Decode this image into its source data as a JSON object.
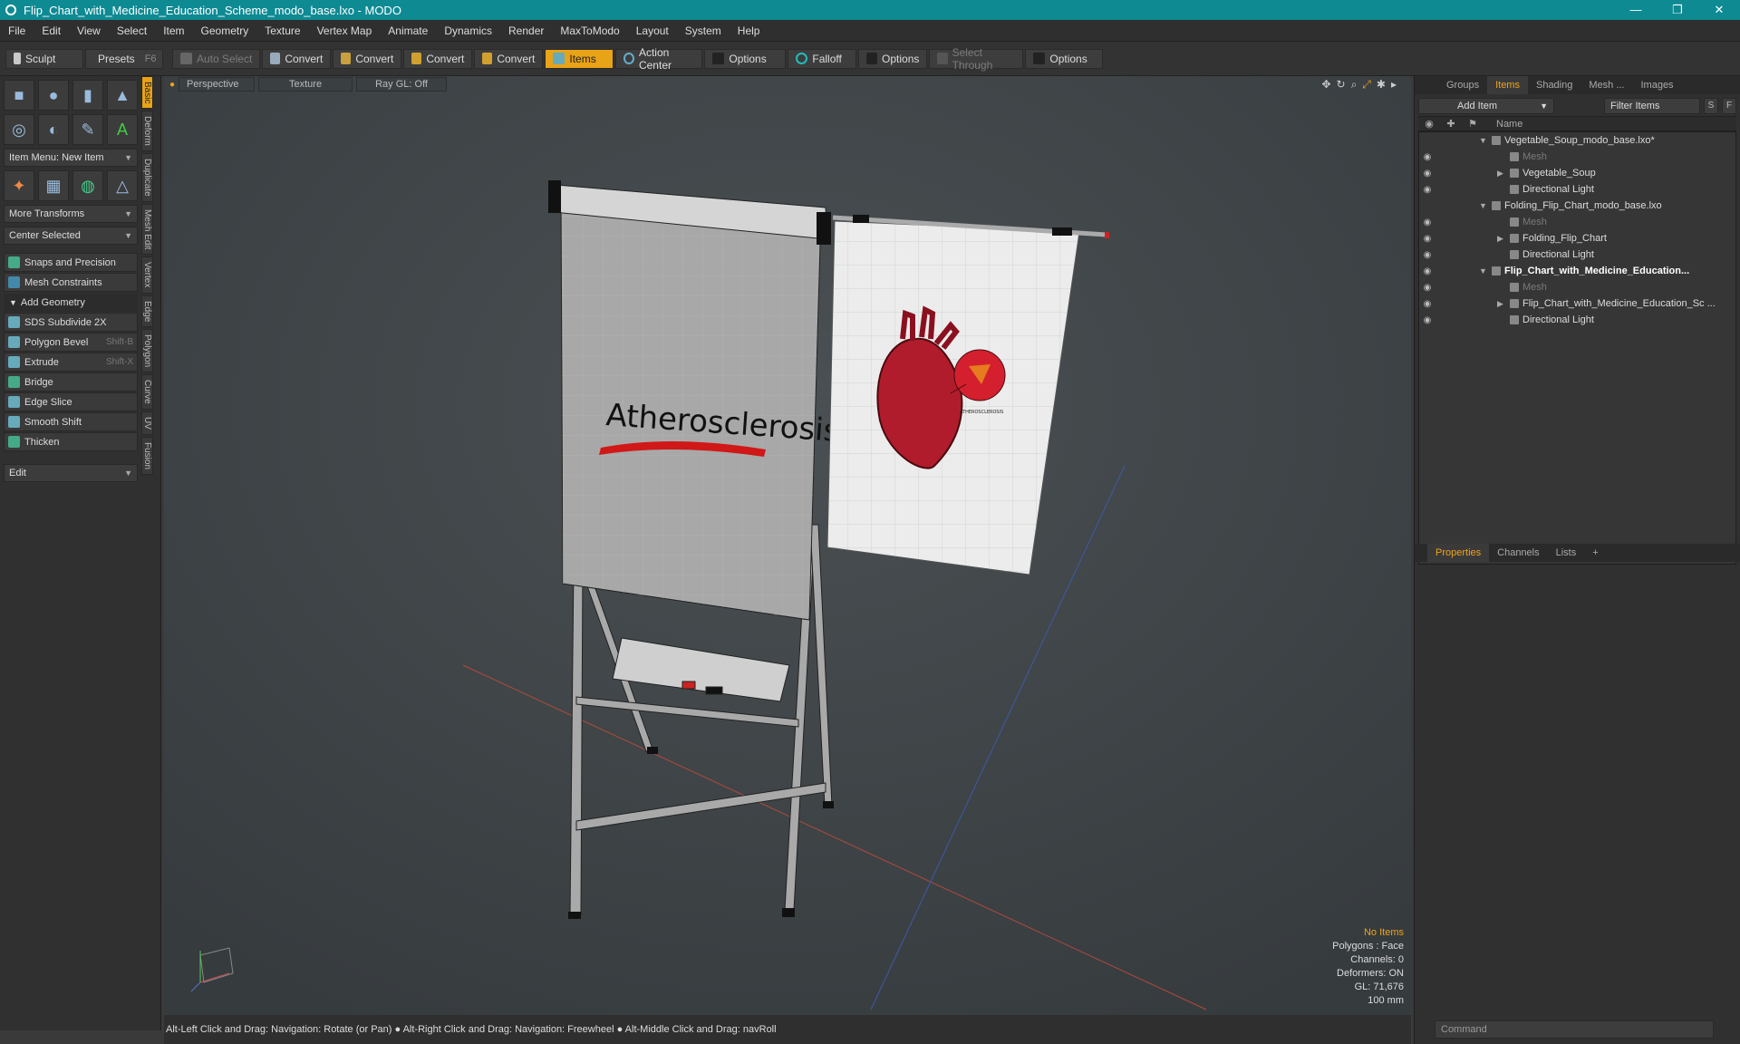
{
  "window": {
    "title": "Flip_Chart_with_Medicine_Education_Scheme_modo_base.lxo - MODO",
    "minimize": "—",
    "maximize": "❐",
    "close": "✕"
  },
  "menu": [
    "File",
    "Edit",
    "View",
    "Select",
    "Item",
    "Geometry",
    "Texture",
    "Vertex Map",
    "Animate",
    "Dynamics",
    "Render",
    "MaxToModo",
    "Layout",
    "System",
    "Help"
  ],
  "toolbar": {
    "sculpt": "Sculpt",
    "presets": "Presets",
    "presets_key": "F6",
    "auto_select": "Auto Select",
    "convert1": "Convert",
    "convert2": "Convert",
    "convert3": "Convert",
    "convert4": "Convert",
    "items": "Items",
    "action_center": "Action Center",
    "options1": "Options",
    "falloff": "Falloff",
    "options2": "Options",
    "select_through": "Select Through",
    "options3": "Options"
  },
  "left": {
    "item_menu": "Item Menu: New Item",
    "more_transforms": "More Transforms",
    "center_selected": "Center Selected",
    "snaps": "Snaps and Precision",
    "mesh_constraints": "Mesh Constraints",
    "add_geometry": "Add Geometry",
    "tools": [
      {
        "label": "SDS Subdivide 2X",
        "key": ""
      },
      {
        "label": "Polygon Bevel",
        "key": "Shift-B"
      },
      {
        "label": "Extrude",
        "key": "Shift-X"
      },
      {
        "label": "Bridge",
        "key": ""
      },
      {
        "label": "Edge Slice",
        "key": ""
      },
      {
        "label": "Smooth Shift",
        "key": ""
      },
      {
        "label": "Thicken",
        "key": ""
      }
    ],
    "edit": "Edit",
    "vtabs": [
      "Basic",
      "Deform",
      "Duplicate",
      "Mesh Edit",
      "Vertex",
      "Edge",
      "Polygon",
      "Curve",
      "UV",
      "Fusion"
    ]
  },
  "viewport": {
    "perspective": "Perspective",
    "texture": "Texture",
    "raygl": "Ray GL: Off",
    "info": {
      "no_items": "No Items",
      "polygons": "Polygons : Face",
      "channels": "Channels: 0",
      "deformers": "Deformers: ON",
      "gl": "GL: 71,676",
      "scale": "100 mm"
    },
    "chart_text": "Atherosclerosis",
    "small_label": "ATHEROSCLEROSIS"
  },
  "status": "Alt-Left Click and Drag: Navigation: Rotate (or Pan) ● Alt-Right Click and Drag: Navigation: Freewheel ● Alt-Middle Click and Drag: navRoll",
  "right": {
    "tabs": [
      "Groups",
      "Items",
      "Shading",
      "Mesh ...",
      "Images"
    ],
    "add_item": "Add Item",
    "filter": "Filter Items",
    "s": "S",
    "f": "F",
    "name_col": "Name",
    "rows": [
      {
        "label": "Vegetable_Soup_modo_base.lxo*",
        "indent": 0,
        "arrow": "▼",
        "eye": "",
        "style": "normal"
      },
      {
        "label": "Mesh",
        "indent": 1,
        "arrow": "",
        "eye": "◉",
        "style": "dim"
      },
      {
        "label": "Vegetable_Soup",
        "indent": 1,
        "arrow": "▶",
        "eye": "◉",
        "style": "normal"
      },
      {
        "label": "Directional Light",
        "indent": 1,
        "arrow": "",
        "eye": "◉",
        "style": "normal"
      },
      {
        "label": "Folding_Flip_Chart_modo_base.lxo",
        "indent": 0,
        "arrow": "▼",
        "eye": "",
        "style": "normal"
      },
      {
        "label": "Mesh",
        "indent": 1,
        "arrow": "",
        "eye": "◉",
        "style": "dim"
      },
      {
        "label": "Folding_Flip_Chart",
        "indent": 1,
        "arrow": "▶",
        "eye": "◉",
        "style": "normal"
      },
      {
        "label": "Directional Light",
        "indent": 1,
        "arrow": "",
        "eye": "◉",
        "style": "normal"
      },
      {
        "label": "Flip_Chart_with_Medicine_Education...",
        "indent": 0,
        "arrow": "▼",
        "eye": "◉",
        "style": "bold"
      },
      {
        "label": "Mesh",
        "indent": 1,
        "arrow": "",
        "eye": "◉",
        "style": "dim"
      },
      {
        "label": "Flip_Chart_with_Medicine_Education_Sc ...",
        "indent": 1,
        "arrow": "▶",
        "eye": "◉",
        "style": "normal"
      },
      {
        "label": "Directional Light",
        "indent": 1,
        "arrow": "",
        "eye": "◉",
        "style": "normal"
      }
    ],
    "prop_tabs": [
      "Properties",
      "Channels",
      "Lists"
    ],
    "command": "Command"
  }
}
